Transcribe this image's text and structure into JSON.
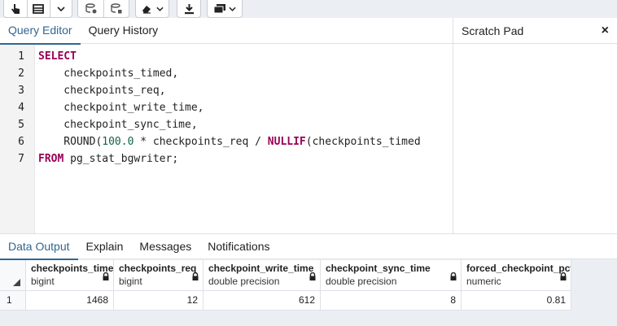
{
  "editor": {
    "tabs": [
      "Query Editor",
      "Query History"
    ],
    "line_numbers": [
      "1",
      "2",
      "3",
      "4",
      "5",
      "6",
      "7"
    ],
    "code": {
      "l1_kw": "SELECT",
      "l2": "    checkpoints_timed,",
      "l3": "    checkpoints_req,",
      "l4": "    checkpoint_write_time,",
      "l5": "    checkpoint_sync_time,",
      "l6_a": "    ROUND(",
      "l6_num": "100.0",
      "l6_b": " * checkpoints_req / ",
      "l6_kw": "NULLIF",
      "l6_c": "(checkpoints_timed",
      "l7_kw": "FROM",
      "l7_rest": " pg_stat_bgwriter;"
    }
  },
  "scratch_pad": {
    "title": "Scratch Pad",
    "close": "×"
  },
  "output": {
    "tabs": [
      "Data Output",
      "Explain",
      "Messages",
      "Notifications"
    ],
    "columns": [
      {
        "name": "checkpoints_timed",
        "type": "bigint"
      },
      {
        "name": "checkpoints_req",
        "type": "bigint"
      },
      {
        "name": "checkpoint_write_time",
        "type": "double precision"
      },
      {
        "name": "checkpoint_sync_time",
        "type": "double precision"
      },
      {
        "name": "forced_checkpoint_pct",
        "type": "numeric"
      }
    ],
    "rows": [
      {
        "num": "1",
        "cells": [
          "1468",
          "12",
          "612",
          "8",
          "0.81"
        ]
      }
    ]
  },
  "colors": {
    "accent": "#326690",
    "keyword": "#990055",
    "number": "#116644"
  }
}
